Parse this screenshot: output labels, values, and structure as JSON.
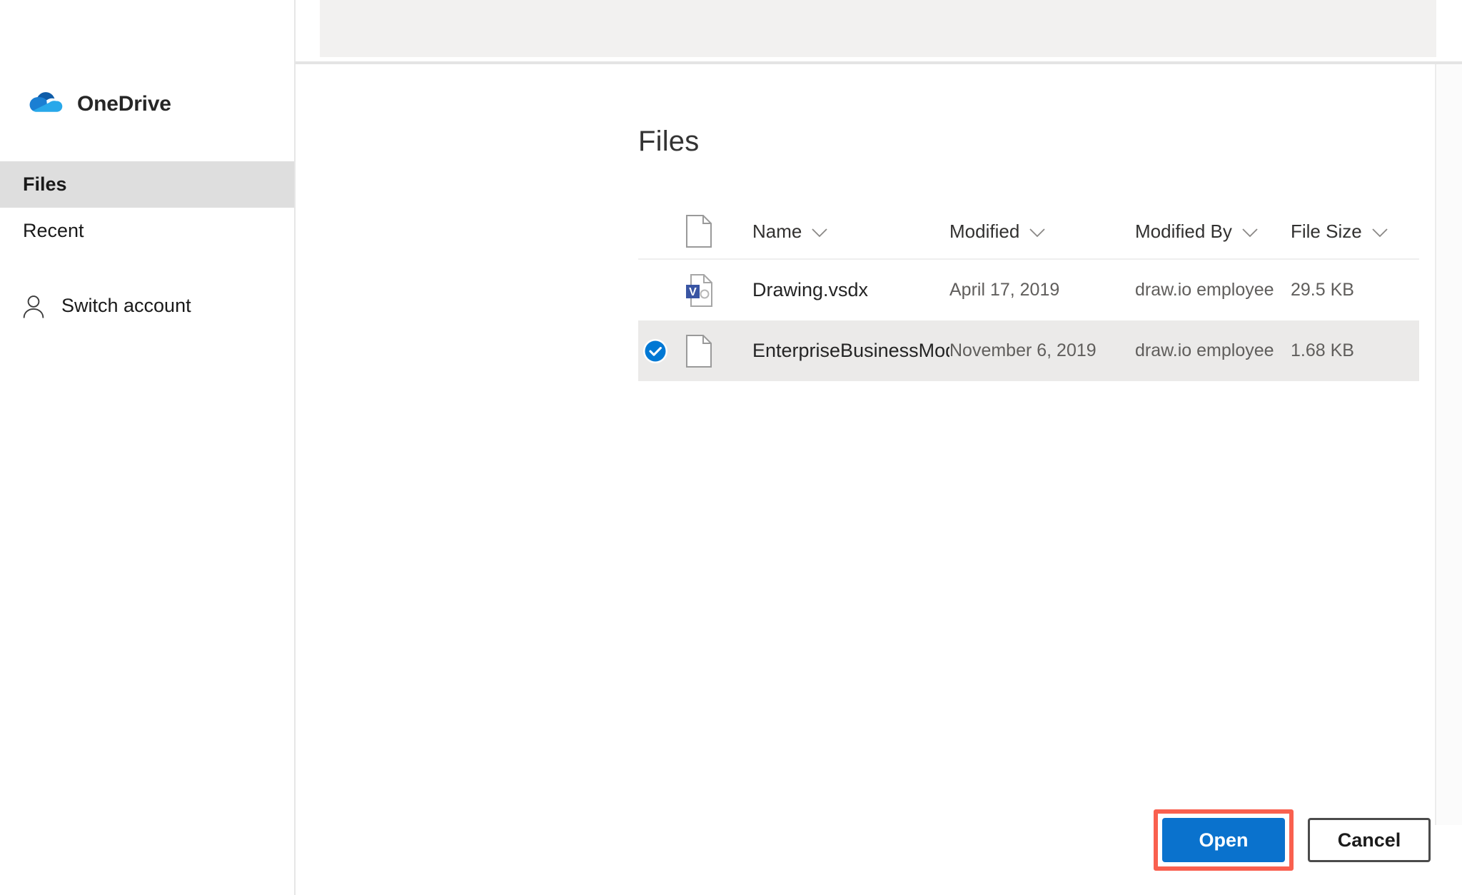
{
  "sidebar": {
    "brand": {
      "name": "OneDrive",
      "logo_icon": "onedrive-cloud-icon"
    },
    "items": [
      {
        "label": "Files",
        "selected": true,
        "icon": null
      },
      {
        "label": "Recent",
        "selected": false,
        "icon": null
      },
      {
        "label": "Switch account",
        "selected": false,
        "icon": "person-icon"
      }
    ]
  },
  "main": {
    "title": "Files",
    "table": {
      "columns": [
        {
          "key": "icon",
          "label": "",
          "icon": "file-icon",
          "sortable": false
        },
        {
          "key": "name",
          "label": "Name",
          "sort_icon": "chevron-down-icon"
        },
        {
          "key": "modified",
          "label": "Modified",
          "sort_icon": "chevron-down-icon"
        },
        {
          "key": "modified_by",
          "label": "Modified By",
          "sort_icon": "chevron-down-icon"
        },
        {
          "key": "size",
          "label": "File Size",
          "sort_icon": "chevron-down-icon"
        }
      ],
      "rows": [
        {
          "name": "Drawing.vsdx",
          "modified": "April 17, 2019",
          "modified_by": "draw.io employee",
          "size": "29.5 KB",
          "selected": false,
          "file_icon": "visio-file-icon"
        },
        {
          "name": "EnterpriseBusinessModelTemplate.drawio",
          "modified": "November 6, 2019",
          "modified_by": "draw.io employee",
          "size": "1.68 KB",
          "selected": true,
          "file_icon": "generic-file-icon"
        }
      ]
    }
  },
  "footer": {
    "open_label": "Open",
    "cancel_label": "Cancel"
  },
  "colors": {
    "primary_button": "#0a72cd",
    "highlight_annotation": "#f9604f",
    "selected_row": "#ebeae9",
    "selected_nav": "#dedede",
    "checkmark_blue": "#0078d4",
    "visio_blue": "#3955a3",
    "toolbar_gray": "#f2f1f0"
  }
}
